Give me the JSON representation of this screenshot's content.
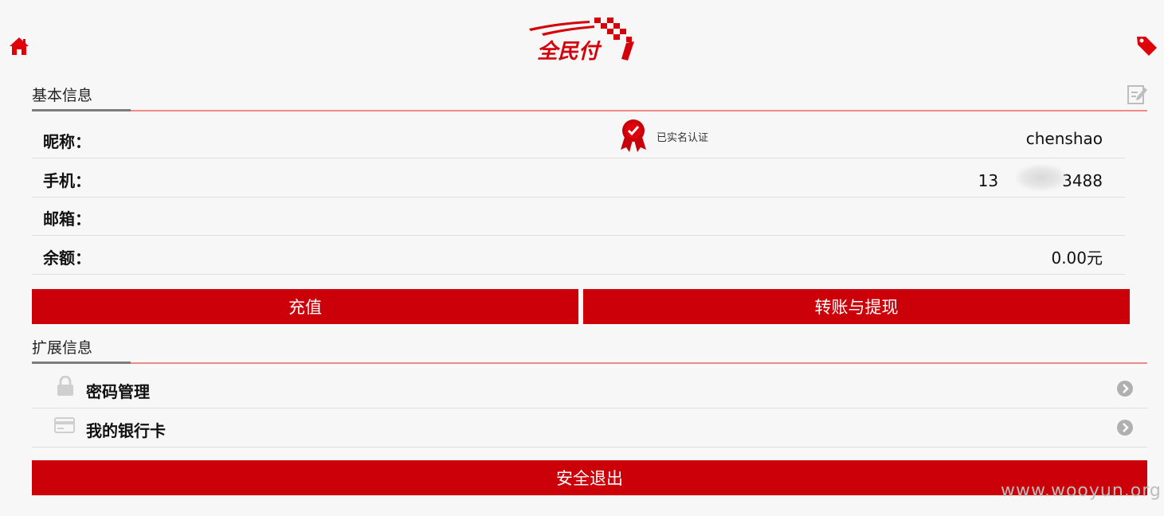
{
  "header": {
    "home_icon": "home-icon",
    "tag_icon": "tag-icon",
    "logo_text": "全民付"
  },
  "basic_info": {
    "title": "基本信息",
    "edit_icon": "edit-icon",
    "verified_text": "已实名认证",
    "rows": [
      {
        "label": "昵称：",
        "value": "chenshao"
      },
      {
        "label": "手机：",
        "value": "13　　　　3488"
      },
      {
        "label": "邮箱：",
        "value": ""
      },
      {
        "label": "余额：",
        "value": "0.00元"
      }
    ]
  },
  "actions": {
    "recharge": "充值",
    "transfer": "转账与提现"
  },
  "extended_info": {
    "title": "扩展信息",
    "items": [
      {
        "label": "密码管理",
        "icon": "lock-icon"
      },
      {
        "label": "我的银行卡",
        "icon": "card-icon"
      }
    ]
  },
  "logout": "安全退出",
  "watermark": "www.wooyun.org",
  "colors": {
    "brand_red": "#cc0008",
    "divider_pink": "#ef8a8a",
    "background": "#f7f7f7"
  }
}
